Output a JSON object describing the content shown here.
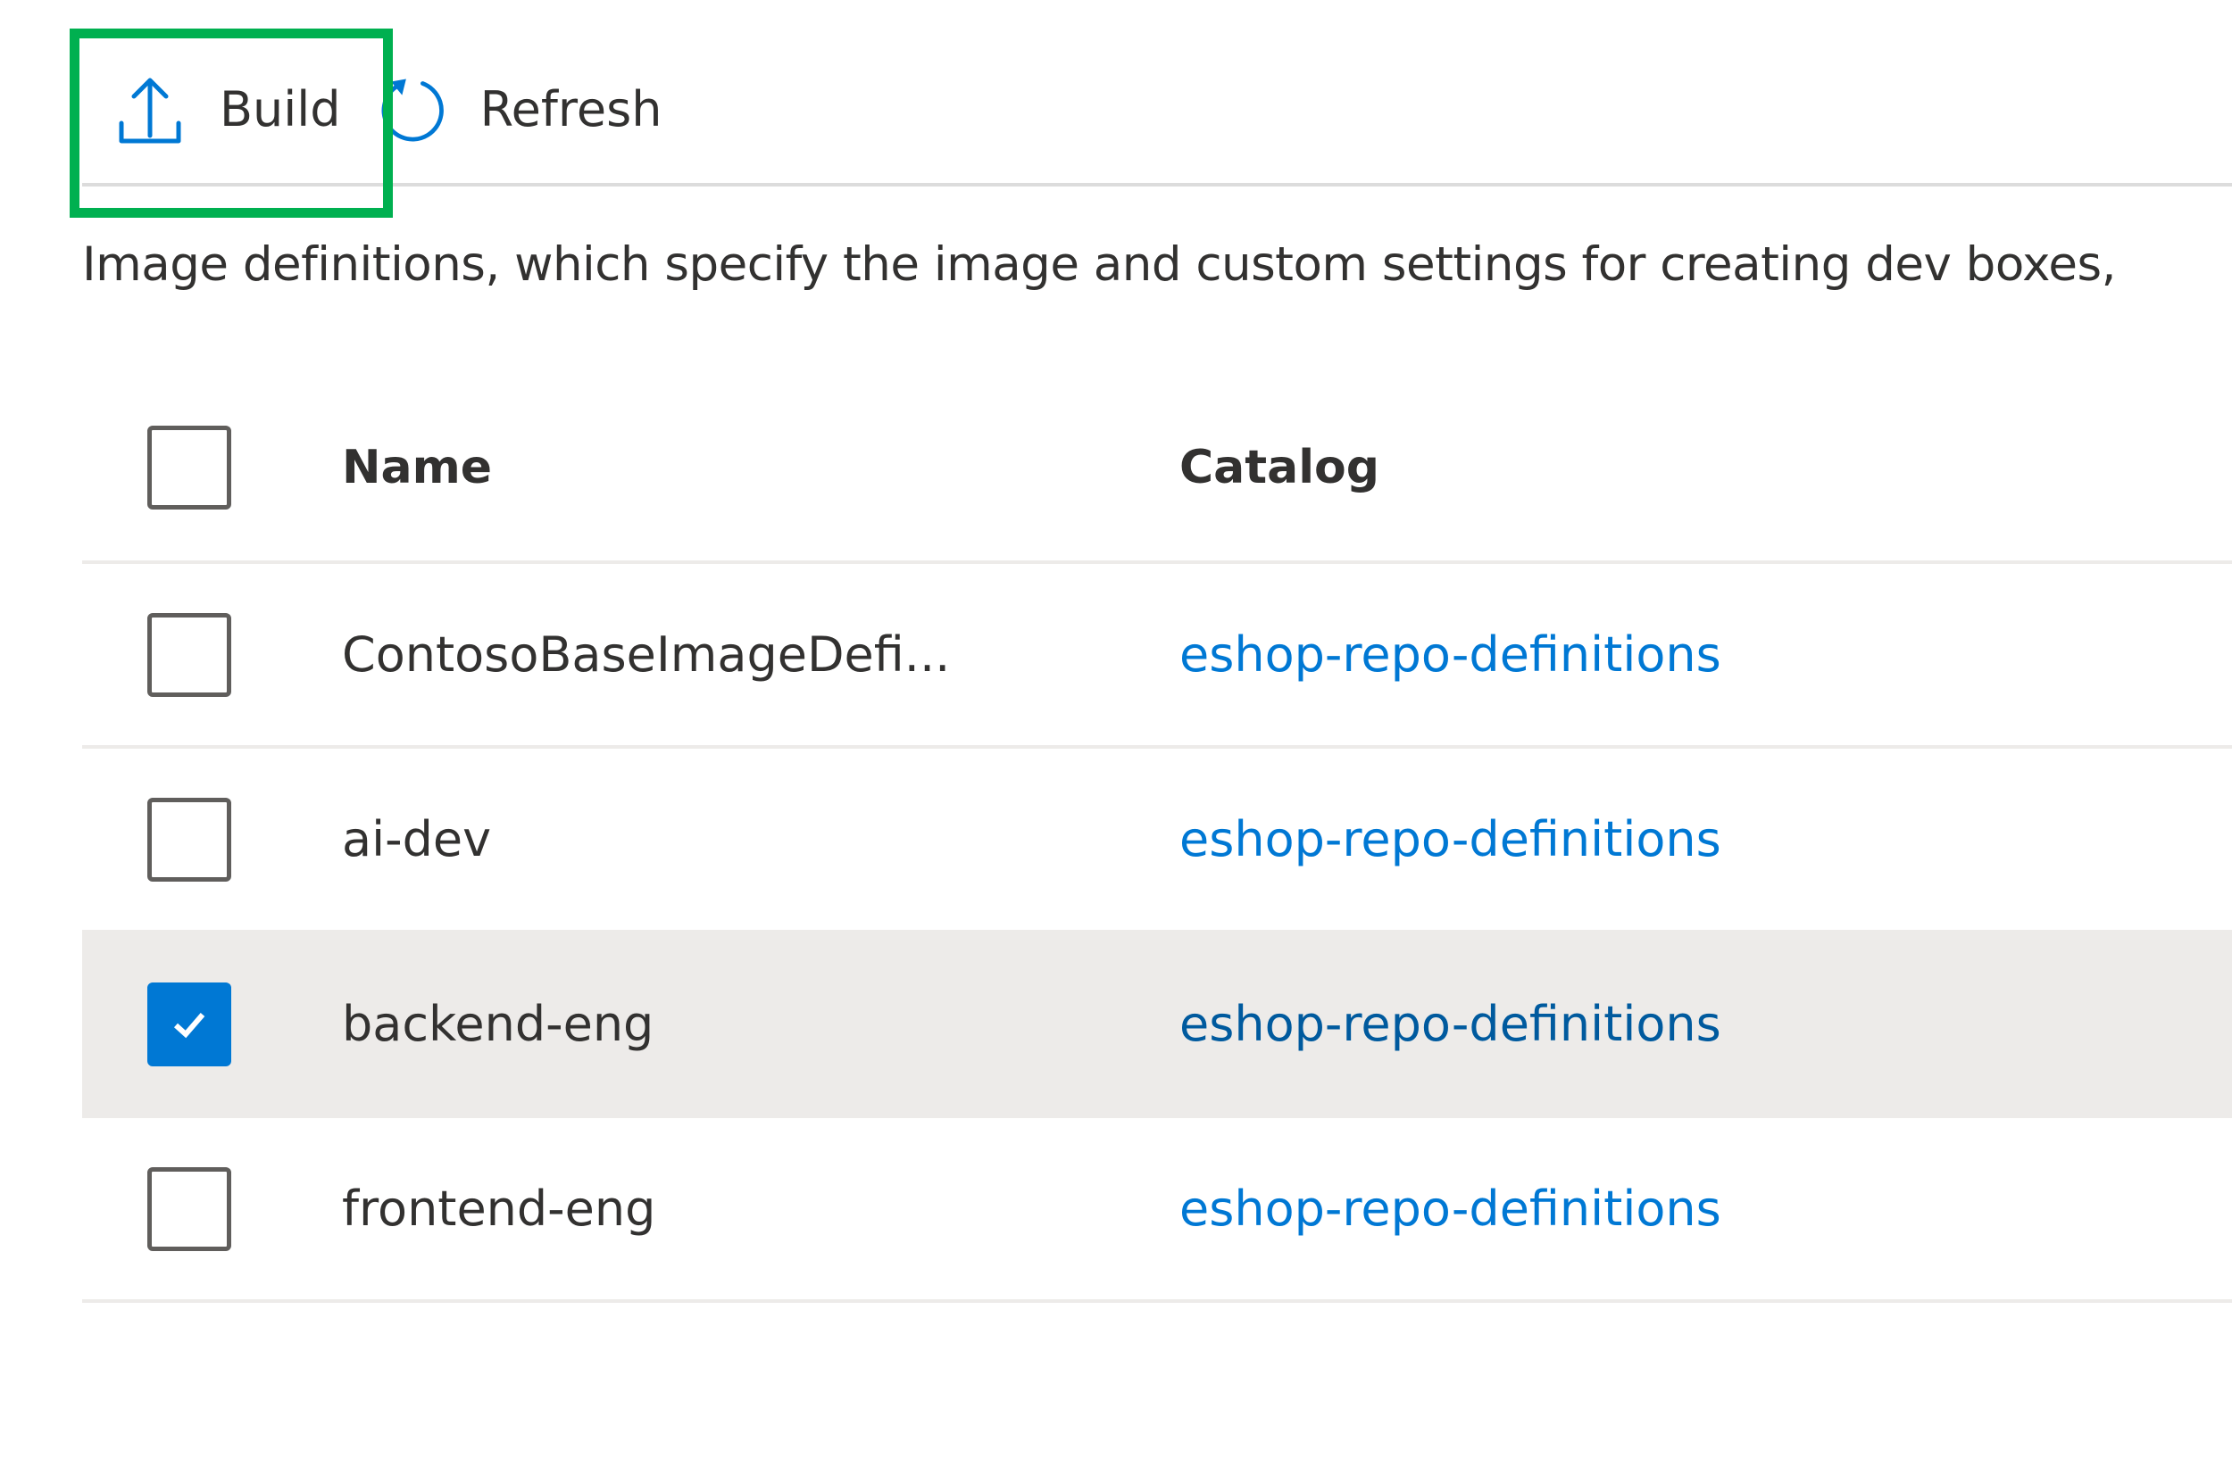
{
  "toolbar": {
    "build_label": "Build",
    "build_icon": "upload-icon",
    "refresh_label": "Refresh",
    "refresh_icon": "refresh-icon",
    "highlighted_button": "build"
  },
  "description": "Image definitions, which specify the image and custom settings for creating dev boxes,",
  "table": {
    "columns": [
      "Name",
      "Catalog"
    ],
    "rows": [
      {
        "name": "ContosoBaseImageDefi...",
        "catalog": "eshop-repo-definitions",
        "selected": false
      },
      {
        "name": "ai-dev",
        "catalog": "eshop-repo-definitions",
        "selected": false
      },
      {
        "name": "backend-eng",
        "catalog": "eshop-repo-definitions",
        "selected": true
      },
      {
        "name": "frontend-eng",
        "catalog": "eshop-repo-definitions",
        "selected": false
      }
    ]
  },
  "colors": {
    "accent": "#0078d4",
    "highlight": "#00b050",
    "selected_row_bg": "#edebe9"
  }
}
